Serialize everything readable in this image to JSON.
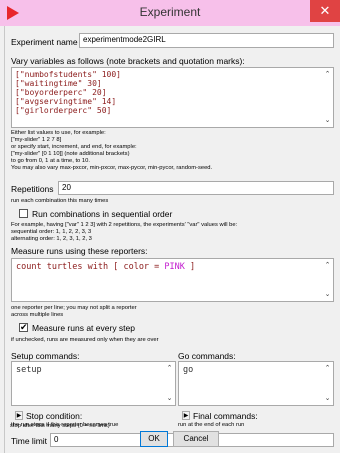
{
  "window": {
    "title": "Experiment",
    "close": "✕"
  },
  "experiment_name": {
    "label": "Experiment name",
    "value": "experimentmode2GIRL"
  },
  "vary": {
    "label": "Vary variables as follows (note brackets and quotation marks):",
    "lines": [
      "[\"numbofstudents\" 100]",
      "[\"waitingtime\" 30]",
      "[\"boyorderperc\" 20]",
      "[\"avgservingtime\" 14]",
      "[\"girlorderperc\" 50]"
    ],
    "help": [
      "Either list values to use, for example:",
      "[\"my-slider\" 1 2 7 8]",
      "or specify start, increment, and end, for example:",
      "[\"my-slider\" [0 1 10]] (note additional brackets)",
      "to go from 0, 1 at a time, to 10.",
      "You may also vary max-pxcor, min-pxcor, max-pycor, min-pycor, random-seed."
    ]
  },
  "repetitions": {
    "label": "Repetitions",
    "value": "20",
    "help": "run each combination this many times"
  },
  "sequential": {
    "label": "Run combinations in sequential order",
    "help": [
      "For example, having [\"var\" 1 2 3] with 2 repetitions, the experiments' \"var\" values will be:",
      "sequential order: 1, 1, 2, 2, 3, 3",
      "alternating order: 1, 2, 3, 1, 2, 3"
    ]
  },
  "measure": {
    "label": "Measure runs using these reporters:",
    "code": "count turtles with [ color = PINK ]",
    "help": [
      "one reporter per line; you may not split a reporter",
      "across multiple lines"
    ]
  },
  "every_step": {
    "label": "Measure runs at every step",
    "checked": true,
    "help": "if unchecked, runs are measured only when they are over"
  },
  "setup": {
    "label": "Setup commands:",
    "value": "setup"
  },
  "go": {
    "label": "Go commands:",
    "value": "go"
  },
  "stop": {
    "label": "Stop condition:",
    "help": "the run stops if this reporter becomes true"
  },
  "final": {
    "label": "Final commands:",
    "help": "run at the end of each run"
  },
  "time_limit": {
    "label": "Time limit",
    "value": "0",
    "help": "stop after this many steps (0 = no limit)"
  },
  "buttons": {
    "ok": "OK",
    "cancel": "Cancel"
  },
  "colors": {
    "titlebar": "#f7c0ea",
    "close": "#e04343",
    "pink_keyword": "#c21ccf",
    "string": "#8b1a1a"
  }
}
